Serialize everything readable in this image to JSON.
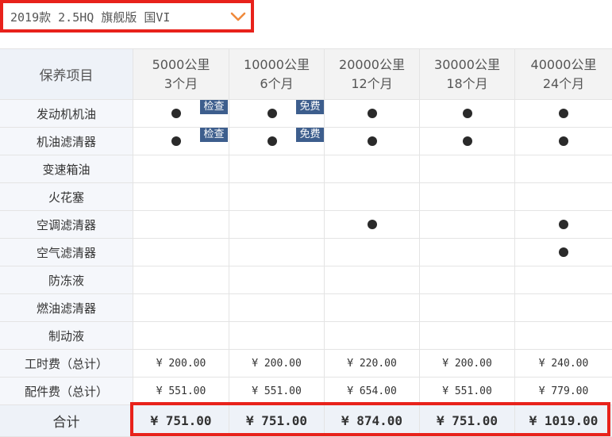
{
  "selector": {
    "value": "2019款 2.5HQ 旗舰版 国VI",
    "icon": "chevron-down-icon",
    "accent": "#f08a3c"
  },
  "table": {
    "header_label": "保养项目",
    "columns": [
      {
        "distance": "5000公里",
        "months": "3个月"
      },
      {
        "distance": "10000公里",
        "months": "6个月"
      },
      {
        "distance": "20000公里",
        "months": "12个月"
      },
      {
        "distance": "30000公里",
        "months": "18个月"
      },
      {
        "distance": "40000公里",
        "months": "24个月"
      }
    ],
    "items": [
      {
        "name": "发动机机油",
        "cells": [
          {
            "dot": true,
            "badge": "检查"
          },
          {
            "dot": true,
            "badge": "免费"
          },
          {
            "dot": true
          },
          {
            "dot": true
          },
          {
            "dot": true
          }
        ]
      },
      {
        "name": "机油滤清器",
        "cells": [
          {
            "dot": true,
            "badge": "检查"
          },
          {
            "dot": true,
            "badge": "免费"
          },
          {
            "dot": true
          },
          {
            "dot": true
          },
          {
            "dot": true
          }
        ]
      },
      {
        "name": "变速箱油",
        "cells": [
          {},
          {},
          {},
          {},
          {}
        ]
      },
      {
        "name": "火花塞",
        "cells": [
          {},
          {},
          {},
          {},
          {}
        ]
      },
      {
        "name": "空调滤清器",
        "cells": [
          {},
          {},
          {
            "dot": true
          },
          {},
          {
            "dot": true
          }
        ]
      },
      {
        "name": "空气滤清器",
        "cells": [
          {},
          {},
          {},
          {},
          {
            "dot": true
          }
        ]
      },
      {
        "name": "防冻液",
        "cells": [
          {},
          {},
          {},
          {},
          {}
        ]
      },
      {
        "name": "燃油滤清器",
        "cells": [
          {},
          {},
          {},
          {},
          {}
        ]
      },
      {
        "name": "制动液",
        "cells": [
          {},
          {},
          {},
          {},
          {}
        ]
      }
    ],
    "labor": {
      "label": "工时费（总计）",
      "values": [
        "¥ 200.00",
        "¥ 200.00",
        "¥ 220.00",
        "¥ 200.00",
        "¥ 240.00"
      ]
    },
    "parts": {
      "label": "配件费（总计）",
      "values": [
        "¥ 551.00",
        "¥ 551.00",
        "¥ 654.00",
        "¥ 551.00",
        "¥ 779.00"
      ]
    },
    "total": {
      "label": "合计",
      "values": [
        "¥ 751.00",
        "¥ 751.00",
        "¥ 874.00",
        "¥ 751.00",
        "¥ 1019.00"
      ]
    }
  },
  "colors": {
    "highlight_border": "#e8221b",
    "badge": "#3d5e8d",
    "dot": "#2a2a2a",
    "header_bg": "#eef2f8"
  }
}
